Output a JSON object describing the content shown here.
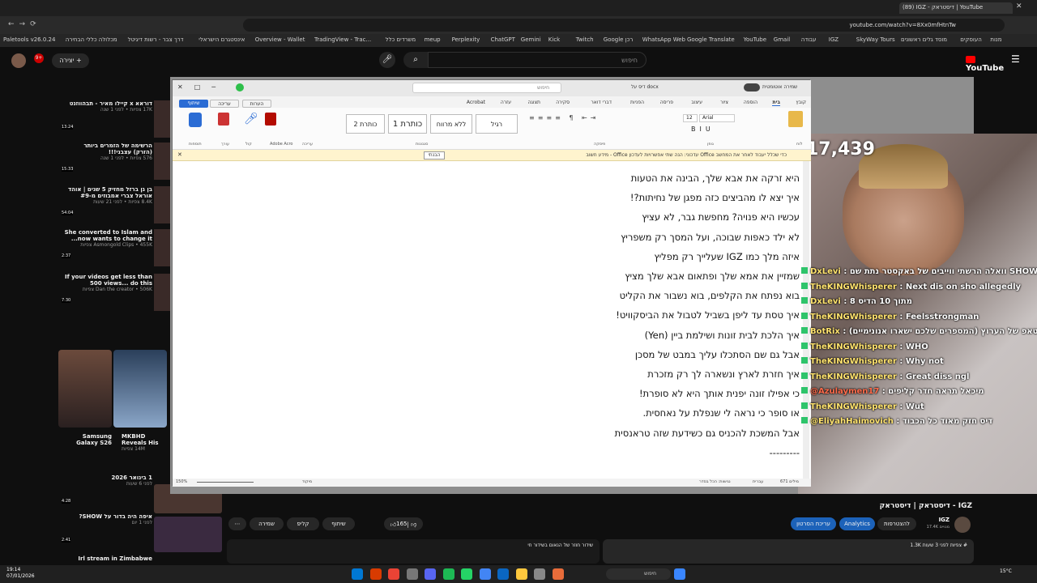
{
  "browser": {
    "url": "youtube.com/watch?v=8Xx0mfHtnTw",
    "tab_title": "(89) IGZ - דיסטראק | YouTube",
    "bookmarks": [
      "Paletools v26.0.24",
      "מכלולה כללי הבחירה",
      "דרך צבר - רשות דיגיטל",
      "אינסטגרם הישראלי",
      "Overview - Wallet",
      "TradingView - Trac...",
      "משרדים כלל",
      "meup",
      "Perplexity",
      "ChatGPT",
      "Gemini",
      "Kick",
      "Twitch",
      "Google רכן",
      "WhatsApp Web",
      "Google Translate",
      "YouTube",
      "Gmail",
      "עבודה",
      "IGZ",
      "SkyWay Tours",
      "מוסד גלים ראשונים",
      "העוסקים",
      "מנות"
    ]
  },
  "youtube": {
    "search_placeholder": "חיפוש",
    "create_label": "יצירה",
    "logo": "YouTube",
    "video_title": "דיסטראק | דיסטראק - IGZ",
    "channel": "IGZ",
    "subscribers": "17.4K מנויים",
    "likes": "165",
    "buttons": [
      "שיתוף",
      "שמירה",
      "קליפ",
      "הורדה"
    ],
    "subscribe_label": "להצטרפות",
    "analytics_label": "Analytics",
    "edit_video_label": "עריכת הסרטון",
    "desc_meta": "1.3K צפיות לפני 3 שעות #",
    "comment_promo": "שידור חוזר של הנאום בשידור חי"
  },
  "sidebar": [
    {
      "title": "דוראא x קיילו מאיר - תבהווזנט",
      "meta": "17K צפיות • לפני 1 שנה",
      "time": "13:24"
    },
    {
      "title": "הרשימה של הזמרים ביותר (הזרק) עצבני!!!",
      "meta": "576 צפיות • לפני 1 שנה",
      "time": "15:33"
    },
    {
      "title": "בן גן ברזל מחזיק 5 שנים | אוהד אוראל צברי אמבוזים מ-#9",
      "meta": "8.4K צפיות • לפני 21 שעות",
      "time": "54:04"
    },
    {
      "title": "She converted to Islam and now wants to change it...",
      "meta": "Asmongold Clips • 455K צפיות",
      "time": "2:37"
    },
    {
      "title": "If your videos get less than 500 views... do this",
      "meta": "Dan the creator • 506K צפיות",
      "time": "7:30"
    },
    {
      "title": "MKBHD Reveals His",
      "meta": "14M צפיות",
      "time": ""
    },
    {
      "title": "Samsung Galaxy S26",
      "meta": "",
      "time": ""
    },
    {
      "title": "1 בינואר 2026",
      "meta": "לפני 6 שעות",
      "time": "4:28"
    },
    {
      "title": "איפה היה בדור על SHOW?",
      "meta": "לפני 1 יום",
      "time": "2:41"
    },
    {
      "title": "Irl stream in Zimbabwe",
      "meta": "",
      "time": ""
    }
  ],
  "word": {
    "search_placeholder": "חיפוש",
    "autosave_label": "שמירה אוטומטית",
    "doc_title": "דיס על docx",
    "tabs": [
      "קובץ",
      "בית",
      "הוספה",
      "ציור",
      "עיצוב",
      "פריסה",
      "הפניות",
      "דברי דואר",
      "סקירה",
      "תצוגה",
      "עזרה",
      "Acrobat"
    ],
    "styles": [
      "רגיל",
      "ללא מרווח",
      "כותרת 1",
      "כותרת 2"
    ],
    "font": "Arial",
    "font_size": "12",
    "group_labels": [
      "לוח",
      "גופן",
      "פיסקה",
      "סגנונות",
      "עריכה",
      "קול",
      "עורך",
      "תוספות",
      "Adobe Acro"
    ],
    "mode_labels": [
      "עריכה",
      "שיתוף",
      "הערות"
    ],
    "banner": "מידע חשוב - Office עדכוני: הנה שתי אפשרויות לעדכון Office כדי שכלל יעבוד לאחר את המחשב",
    "banner_button": "הבנתי",
    "lines": [
      "היא זרקה את אבא שלך, הבינה את הטעות",
      "איך יצא לו מהביצים כזה מפגן של נחיתות?!",
      "עכשיו היא פנויה? מחפשת גבר, לא עציץ",
      "לא ילד כאפות שבוכה, ועל המסך רק משפריץ",
      "איזה מלך כמו IGZ שעלייך רק מפליץ",
      "שמזיין את אמא שלך ופתאום אבא שלך מציץ",
      "בוא נפתח את הקלפים, בוא נשבור את הקליט",
      "איך טסת עד ליפן בשביל לטבול את הביסקוויט!",
      "איך הלכת לבית זונות ושילמת ביין (Yen)",
      "אבל גם שם הסתכלו עליך במבט של מסכן",
      "איך חזרת לארץ ונשארה לך רק מזכרת",
      "כי אפילו זונה יפנית אותך היא לא סופרת!",
      "או סופר כי נראה לי שנפלת על נאחסית.",
      "אבל המשכת להכניס גם כשידעת שזה טראנסית",
      "---------"
    ],
    "status": {
      "zoom": "150%",
      "words": "671 מילים",
      "lang": "עברית",
      "focus": "מיקוד",
      "acc": "נגישות: הכל בסדר"
    }
  },
  "stream": {
    "viewers": "17,439",
    "chat": [
      {
        "user": "DxLevi",
        "msg": ": וואלה הרשתי ווייבים של באקסטר נתת שם SHOW",
        "color": "#ffe36e"
      },
      {
        "user": "TheKINGWhisperer",
        "msg": ": Next dis on sho allegedly",
        "color": "#ffe36e"
      },
      {
        "user": "DxLevi",
        "msg": ": מתוך 10 הדיס 8",
        "color": "#ffe36e"
      },
      {
        "user": "TheKINGWhisperer",
        "msg": ": Feelsstrongman",
        "color": "#ffe36e"
      },
      {
        "user": "BotRix",
        "msg": ": הואוסטאפ של הערוץ (המספרים שלכם ישארו אנונימיים)",
        "color": "#ffe36e"
      },
      {
        "user": "TheKINGWhisperer",
        "msg": ": WHO",
        "color": "#ffe36e"
      },
      {
        "user": "TheKINGWhisperer",
        "msg": ": Why not",
        "color": "#ffe36e"
      },
      {
        "user": "TheKINGWhisperer",
        "msg": ": Great diss ngl",
        "color": "#ffe36e"
      },
      {
        "user": "@Azulaymen17",
        "msg": ": מיכאל תראה חדר קליפים",
        "color": "#ff6a4a"
      },
      {
        "user": "TheKINGWhisperer",
        "msg": ": Wut",
        "color": "#ffe36e"
      },
      {
        "user": "@EliyahHaimovich",
        "msg": ": דיס חזק מאוד כל הכבוד",
        "color": "#ffe36e"
      }
    ]
  },
  "taskbar": {
    "time": "19:14",
    "date": "07/01/2026",
    "search": "חיפוש",
    "weather": "15°C"
  }
}
